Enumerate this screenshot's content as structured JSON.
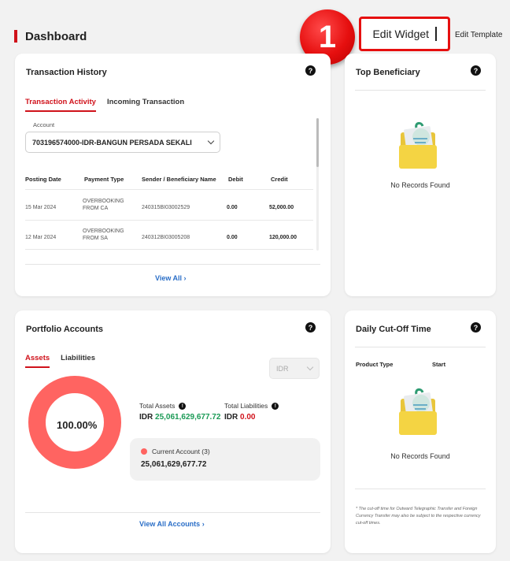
{
  "header": {
    "title": "Dashboard"
  },
  "step_badge": "1",
  "toolbar": {
    "edit_widget": "Edit Widget",
    "edit_template": "Edit Template"
  },
  "transaction_history": {
    "title": "Transaction History",
    "tabs": [
      "Transaction Activity",
      "Incoming Transaction"
    ],
    "account_label": "Account",
    "account_value": "703196574000-IDR-BANGUN PERSADA SEKALI",
    "columns": [
      "Posting Date",
      "Payment Type",
      "Sender / Beneficiary Name",
      "Debit",
      "Credit"
    ],
    "rows": [
      {
        "date": "15 Mar 2024",
        "type1": "OVERBOOKING",
        "type2": "FROM CA",
        "name": "240315BI03002529",
        "debit": "0.00",
        "credit": "52,000.00"
      },
      {
        "date": "12 Mar 2024",
        "type1": "OVERBOOKING",
        "type2": "FROM SA",
        "name": "240312BI03005208",
        "debit": "0.00",
        "credit": "120,000.00"
      }
    ],
    "view_all": "View All"
  },
  "top_beneficiary": {
    "title": "Top Beneficiary",
    "empty": "No Records Found"
  },
  "portfolio": {
    "title": "Portfolio Accounts",
    "tabs": [
      "Assets",
      "Liabilities"
    ],
    "currency": "IDR",
    "donut_label": "100.00%",
    "donut_color": "#ff6461",
    "total_assets_label": "Total Assets",
    "total_assets_currency": "IDR",
    "total_assets_value": "25,061,629,677.72",
    "total_liabilities_label": "Total Liabilities",
    "total_liabilities_currency": "IDR",
    "total_liabilities_value": "0.00",
    "account_name": "Current Account (3)",
    "account_value": "25,061,629,677.72",
    "view_all": "View All Accounts"
  },
  "cutoff": {
    "title": "Daily Cut-Off Time",
    "columns": [
      "Product Type",
      "Start"
    ],
    "empty": "No Records Found",
    "footnote": "* The cut-off time for Outward Telegraphic Transfer and Foreign Currency Transfer may also be subject to the respective currency cut-off times."
  },
  "icons": {
    "help": "?",
    "info": "!"
  }
}
